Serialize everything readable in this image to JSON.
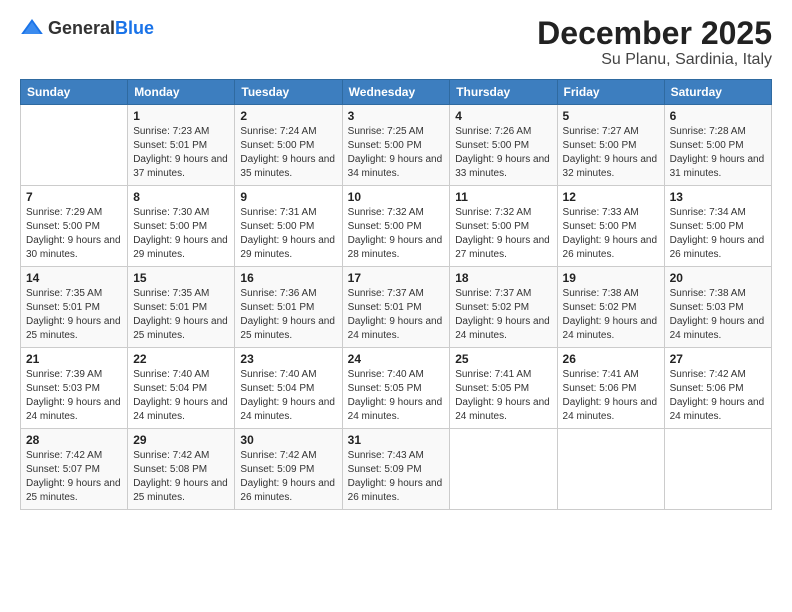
{
  "header": {
    "logo_general": "General",
    "logo_blue": "Blue",
    "title": "December 2025",
    "subtitle": "Su Planu, Sardinia, Italy"
  },
  "weekdays": [
    "Sunday",
    "Monday",
    "Tuesday",
    "Wednesday",
    "Thursday",
    "Friday",
    "Saturday"
  ],
  "weeks": [
    [
      {
        "day": "",
        "sunrise": "",
        "sunset": "",
        "daylight": ""
      },
      {
        "day": "1",
        "sunrise": "Sunrise: 7:23 AM",
        "sunset": "Sunset: 5:01 PM",
        "daylight": "Daylight: 9 hours and 37 minutes."
      },
      {
        "day": "2",
        "sunrise": "Sunrise: 7:24 AM",
        "sunset": "Sunset: 5:00 PM",
        "daylight": "Daylight: 9 hours and 35 minutes."
      },
      {
        "day": "3",
        "sunrise": "Sunrise: 7:25 AM",
        "sunset": "Sunset: 5:00 PM",
        "daylight": "Daylight: 9 hours and 34 minutes."
      },
      {
        "day": "4",
        "sunrise": "Sunrise: 7:26 AM",
        "sunset": "Sunset: 5:00 PM",
        "daylight": "Daylight: 9 hours and 33 minutes."
      },
      {
        "day": "5",
        "sunrise": "Sunrise: 7:27 AM",
        "sunset": "Sunset: 5:00 PM",
        "daylight": "Daylight: 9 hours and 32 minutes."
      },
      {
        "day": "6",
        "sunrise": "Sunrise: 7:28 AM",
        "sunset": "Sunset: 5:00 PM",
        "daylight": "Daylight: 9 hours and 31 minutes."
      }
    ],
    [
      {
        "day": "7",
        "sunrise": "Sunrise: 7:29 AM",
        "sunset": "Sunset: 5:00 PM",
        "daylight": "Daylight: 9 hours and 30 minutes."
      },
      {
        "day": "8",
        "sunrise": "Sunrise: 7:30 AM",
        "sunset": "Sunset: 5:00 PM",
        "daylight": "Daylight: 9 hours and 29 minutes."
      },
      {
        "day": "9",
        "sunrise": "Sunrise: 7:31 AM",
        "sunset": "Sunset: 5:00 PM",
        "daylight": "Daylight: 9 hours and 29 minutes."
      },
      {
        "day": "10",
        "sunrise": "Sunrise: 7:32 AM",
        "sunset": "Sunset: 5:00 PM",
        "daylight": "Daylight: 9 hours and 28 minutes."
      },
      {
        "day": "11",
        "sunrise": "Sunrise: 7:32 AM",
        "sunset": "Sunset: 5:00 PM",
        "daylight": "Daylight: 9 hours and 27 minutes."
      },
      {
        "day": "12",
        "sunrise": "Sunrise: 7:33 AM",
        "sunset": "Sunset: 5:00 PM",
        "daylight": "Daylight: 9 hours and 26 minutes."
      },
      {
        "day": "13",
        "sunrise": "Sunrise: 7:34 AM",
        "sunset": "Sunset: 5:00 PM",
        "daylight": "Daylight: 9 hours and 26 minutes."
      }
    ],
    [
      {
        "day": "14",
        "sunrise": "Sunrise: 7:35 AM",
        "sunset": "Sunset: 5:01 PM",
        "daylight": "Daylight: 9 hours and 25 minutes."
      },
      {
        "day": "15",
        "sunrise": "Sunrise: 7:35 AM",
        "sunset": "Sunset: 5:01 PM",
        "daylight": "Daylight: 9 hours and 25 minutes."
      },
      {
        "day": "16",
        "sunrise": "Sunrise: 7:36 AM",
        "sunset": "Sunset: 5:01 PM",
        "daylight": "Daylight: 9 hours and 25 minutes."
      },
      {
        "day": "17",
        "sunrise": "Sunrise: 7:37 AM",
        "sunset": "Sunset: 5:01 PM",
        "daylight": "Daylight: 9 hours and 24 minutes."
      },
      {
        "day": "18",
        "sunrise": "Sunrise: 7:37 AM",
        "sunset": "Sunset: 5:02 PM",
        "daylight": "Daylight: 9 hours and 24 minutes."
      },
      {
        "day": "19",
        "sunrise": "Sunrise: 7:38 AM",
        "sunset": "Sunset: 5:02 PM",
        "daylight": "Daylight: 9 hours and 24 minutes."
      },
      {
        "day": "20",
        "sunrise": "Sunrise: 7:38 AM",
        "sunset": "Sunset: 5:03 PM",
        "daylight": "Daylight: 9 hours and 24 minutes."
      }
    ],
    [
      {
        "day": "21",
        "sunrise": "Sunrise: 7:39 AM",
        "sunset": "Sunset: 5:03 PM",
        "daylight": "Daylight: 9 hours and 24 minutes."
      },
      {
        "day": "22",
        "sunrise": "Sunrise: 7:40 AM",
        "sunset": "Sunset: 5:04 PM",
        "daylight": "Daylight: 9 hours and 24 minutes."
      },
      {
        "day": "23",
        "sunrise": "Sunrise: 7:40 AM",
        "sunset": "Sunset: 5:04 PM",
        "daylight": "Daylight: 9 hours and 24 minutes."
      },
      {
        "day": "24",
        "sunrise": "Sunrise: 7:40 AM",
        "sunset": "Sunset: 5:05 PM",
        "daylight": "Daylight: 9 hours and 24 minutes."
      },
      {
        "day": "25",
        "sunrise": "Sunrise: 7:41 AM",
        "sunset": "Sunset: 5:05 PM",
        "daylight": "Daylight: 9 hours and 24 minutes."
      },
      {
        "day": "26",
        "sunrise": "Sunrise: 7:41 AM",
        "sunset": "Sunset: 5:06 PM",
        "daylight": "Daylight: 9 hours and 24 minutes."
      },
      {
        "day": "27",
        "sunrise": "Sunrise: 7:42 AM",
        "sunset": "Sunset: 5:06 PM",
        "daylight": "Daylight: 9 hours and 24 minutes."
      }
    ],
    [
      {
        "day": "28",
        "sunrise": "Sunrise: 7:42 AM",
        "sunset": "Sunset: 5:07 PM",
        "daylight": "Daylight: 9 hours and 25 minutes."
      },
      {
        "day": "29",
        "sunrise": "Sunrise: 7:42 AM",
        "sunset": "Sunset: 5:08 PM",
        "daylight": "Daylight: 9 hours and 25 minutes."
      },
      {
        "day": "30",
        "sunrise": "Sunrise: 7:42 AM",
        "sunset": "Sunset: 5:09 PM",
        "daylight": "Daylight: 9 hours and 26 minutes."
      },
      {
        "day": "31",
        "sunrise": "Sunrise: 7:43 AM",
        "sunset": "Sunset: 5:09 PM",
        "daylight": "Daylight: 9 hours and 26 minutes."
      },
      {
        "day": "",
        "sunrise": "",
        "sunset": "",
        "daylight": ""
      },
      {
        "day": "",
        "sunrise": "",
        "sunset": "",
        "daylight": ""
      },
      {
        "day": "",
        "sunrise": "",
        "sunset": "",
        "daylight": ""
      }
    ]
  ]
}
